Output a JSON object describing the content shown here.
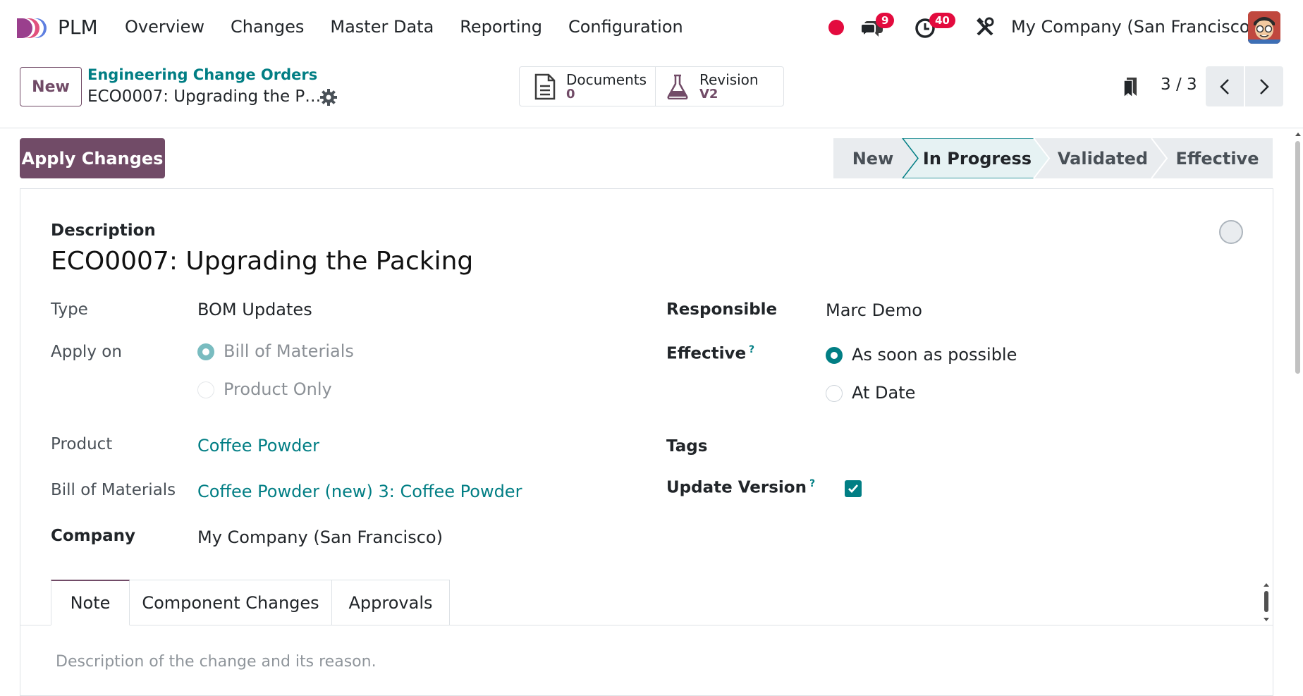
{
  "topbar": {
    "app_name": "PLM",
    "menu": [
      "Overview",
      "Changes",
      "Master Data",
      "Reporting",
      "Configuration"
    ],
    "messages_count": "9",
    "activities_count": "40",
    "company": "My Company (San Francisco)"
  },
  "control_panel": {
    "new_button": "New",
    "breadcrumb_parent": "Engineering Change Orders",
    "breadcrumb_current": "ECO0007: Upgrading the P…",
    "documents_label": "Documents",
    "documents_count": "0",
    "revision_label": "Revision",
    "revision_value": "V2",
    "pager": "3 / 3"
  },
  "statusbar": {
    "apply_button": "Apply Changes",
    "stages": [
      "New",
      "In Progress",
      "Validated",
      "Effective"
    ],
    "current_stage": "In Progress"
  },
  "form": {
    "description_label": "Description",
    "title": "ECO0007: Upgrading the Packing",
    "type_label": "Type",
    "type_value": "BOM Updates",
    "apply_on_label": "Apply on",
    "apply_on_options": [
      "Bill of Materials",
      "Product Only"
    ],
    "product_label": "Product",
    "product_value": "Coffee Powder",
    "bom_label": "Bill of Materials",
    "bom_value": "Coffee Powder (new) 3: Coffee Powder",
    "company_label": "Company",
    "company_value": "My Company (San Francisco)",
    "responsible_label": "Responsible",
    "responsible_value": "Marc Demo",
    "effective_label": "Effective",
    "effective_options": [
      "As soon as possible",
      "At Date"
    ],
    "tags_label": "Tags",
    "update_version_label": "Update Version",
    "help_mark": "?"
  },
  "tabs": [
    "Note",
    "Component Changes",
    "Approvals"
  ],
  "note_placeholder": "Description of the change and its reason.",
  "colors": {
    "brand": "#714b67",
    "accent": "#017e84",
    "badge": "#e30b3e"
  }
}
